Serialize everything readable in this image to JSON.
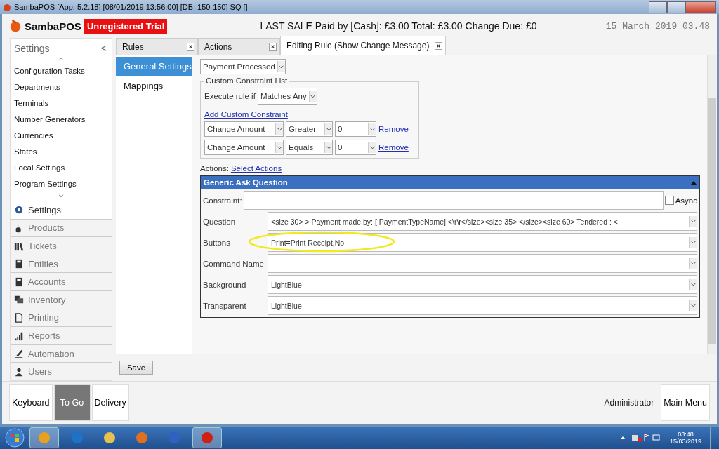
{
  "window": {
    "title": "SambaPOS [App: 5.2.18] [08/01/2019 13:56:00] [DB: 150-150] SQ []"
  },
  "header": {
    "app_name": "SambaPOS",
    "badge": "Unregistered Trial",
    "last_sale": "LAST SALE Paid by [Cash]: £3.00  Total: £3.00  Change Due: £0",
    "date": "15 March 2019 03.48"
  },
  "sidebar": {
    "title": "Settings",
    "collapse": "<",
    "items": [
      "Configuration Tasks",
      "Departments",
      "Terminals",
      "Number Generators",
      "Currencies",
      "States",
      "Local Settings",
      "Program Settings"
    ],
    "sections": [
      {
        "label": "Settings",
        "selected": true
      },
      {
        "label": "Products",
        "selected": false
      },
      {
        "label": "Tickets",
        "selected": false
      },
      {
        "label": "Entities",
        "selected": false
      },
      {
        "label": "Accounts",
        "selected": false
      },
      {
        "label": "Inventory",
        "selected": false
      },
      {
        "label": "Printing",
        "selected": false
      },
      {
        "label": "Reports",
        "selected": false
      },
      {
        "label": "Automation",
        "selected": false
      },
      {
        "label": "Users",
        "selected": false
      }
    ]
  },
  "tabs": [
    {
      "label": "Rules",
      "selected": false
    },
    {
      "label": "Actions",
      "selected": false
    },
    {
      "label": "Editing Rule (Show Change Message)",
      "selected": true
    }
  ],
  "nav": [
    {
      "label": "General Settings",
      "selected": true
    },
    {
      "label": "Mappings",
      "selected": false
    }
  ],
  "rule": {
    "event": "Payment Processed",
    "constraints": {
      "title": "Custom Constraint List",
      "execute_label": "Execute rule if",
      "execute_value": "Matches Any",
      "add_link": "Add Custom Constraint",
      "rows": [
        {
          "field": "Change Amount",
          "operator": "Greater",
          "value": "0",
          "remove": "Remove"
        },
        {
          "field": "Change Amount",
          "operator": "Equals",
          "value": "0",
          "remove": "Remove"
        }
      ]
    },
    "actions_label": "Actions:",
    "actions_link": "Select Actions",
    "action": {
      "title": "Generic Ask Question",
      "constraint_label": "Constraint:",
      "async_label": "Async",
      "async": false,
      "fields": [
        {
          "label": "Question",
          "value": "<size 30> > Payment made by: [:PaymentTypeName] <\\r\\r</size><size 35> </size><size 60> Tendered : <",
          "highlighted": false
        },
        {
          "label": "Buttons",
          "value": "Print=Print Receipt,No",
          "highlighted": true
        },
        {
          "label": "Command Name",
          "highlighted": false
        },
        {
          "label": "Background",
          "value": "LightBlue",
          "highlighted": false
        },
        {
          "label": "Transparent",
          "value": "LightBlue",
          "highlighted": false
        }
      ]
    }
  },
  "save": "Save",
  "footer": {
    "buttons": [
      {
        "label": "Keyboard",
        "selected": false
      },
      {
        "label": "To Go",
        "selected": true
      },
      {
        "label": "Delivery",
        "selected": false
      }
    ],
    "user": "Administrator",
    "main_menu": "Main Menu"
  },
  "taskbar": {
    "apps": [
      {
        "selected": true
      },
      {
        "selected": false
      },
      {
        "selected": false
      },
      {
        "selected": false
      },
      {
        "selected": false
      },
      {
        "selected": true
      }
    ],
    "time": "03:48",
    "date": "15/03/2019"
  }
}
